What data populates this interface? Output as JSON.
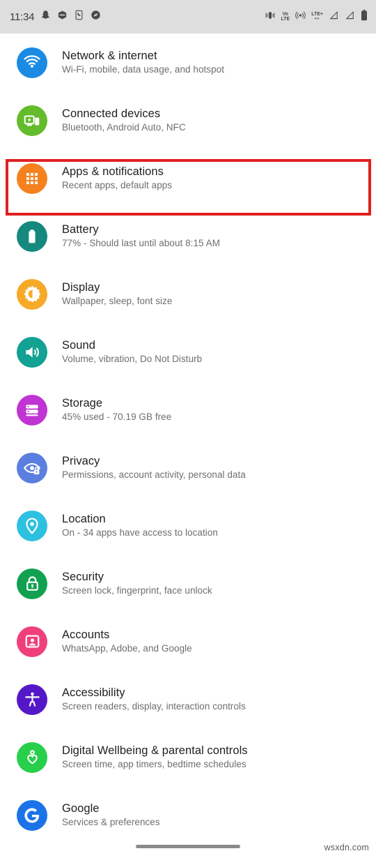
{
  "statusbar": {
    "time": "11:34",
    "left_icons": [
      {
        "name": "snapchat-icon"
      },
      {
        "name": "hexagon-app-icon"
      },
      {
        "name": "phone-app-icon"
      },
      {
        "name": "shazam-icon"
      }
    ],
    "right_icons": [
      {
        "name": "vibrate-icon"
      },
      {
        "name": "volte-icon",
        "label_top": "VoLTE",
        "label_line1": "Vo",
        "label_line2": "LTE"
      },
      {
        "name": "hotspot-icon"
      },
      {
        "name": "lte-plus-icon",
        "label": "LTE+"
      },
      {
        "name": "signal-bars-sim1-icon"
      },
      {
        "name": "signal-bars-sim2-icon"
      },
      {
        "name": "battery-icon"
      }
    ]
  },
  "highlight": {
    "color": "#e02020",
    "target": "Apps & notifications"
  },
  "watermark": "wsxdn.com",
  "settings": {
    "items": [
      {
        "title": "Network & internet",
        "subtitle": "Wi-Fi, mobile, data usage, and hotspot",
        "icon": "wifi-icon",
        "color": "#1a8ae5"
      },
      {
        "title": "Connected devices",
        "subtitle": "Bluetooth, Android Auto, NFC",
        "icon": "cast-devices-icon",
        "color": "#64bb2c"
      },
      {
        "title": "Apps & notifications",
        "subtitle": "Recent apps, default apps",
        "icon": "apps-grid-icon",
        "color": "#f5821f"
      },
      {
        "title": "Battery",
        "subtitle": "77% - Should last until about 8:15 AM",
        "icon": "battery-icon",
        "color": "#16897e"
      },
      {
        "title": "Display",
        "subtitle": "Wallpaper, sleep, font size",
        "icon": "brightness-icon",
        "color": "#f7a928"
      },
      {
        "title": "Sound",
        "subtitle": "Volume, vibration, Do Not Disturb",
        "icon": "volume-icon",
        "color": "#13a193"
      },
      {
        "title": "Storage",
        "subtitle": "45% used - 70.19 GB free",
        "icon": "storage-icon",
        "color": "#c034d4"
      },
      {
        "title": "Privacy",
        "subtitle": "Permissions, account activity, personal data",
        "icon": "privacy-eye-lock-icon",
        "color": "#5b7fe0"
      },
      {
        "title": "Location",
        "subtitle": "On - 34 apps have access to location",
        "icon": "location-pin-icon",
        "color": "#2ec0e0"
      },
      {
        "title": "Security",
        "subtitle": "Screen lock, fingerprint, face unlock",
        "icon": "lock-icon",
        "color": "#12a150"
      },
      {
        "title": "Accounts",
        "subtitle": "WhatsApp, Adobe, and Google",
        "icon": "account-portrait-icon",
        "color": "#ef407c"
      },
      {
        "title": "Accessibility",
        "subtitle": "Screen readers, display, interaction controls",
        "icon": "accessibility-person-icon",
        "color": "#5418c9"
      },
      {
        "title": "Digital Wellbeing & parental controls",
        "subtitle": "Screen time, app timers, bedtime schedules",
        "icon": "wellbeing-heart-icon",
        "color": "#27cf4b"
      },
      {
        "title": "Google",
        "subtitle": "Services & preferences",
        "icon": "google-g-icon",
        "color": "#1a73e8"
      }
    ]
  }
}
